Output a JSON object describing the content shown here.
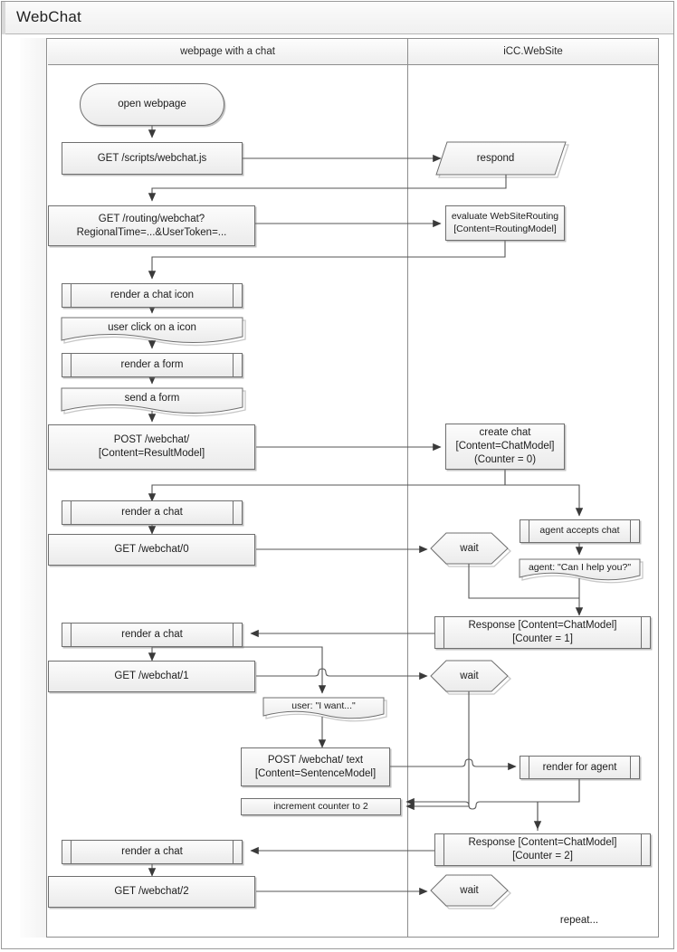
{
  "window": {
    "title": "WebChat"
  },
  "lanes": [
    {
      "id": "client",
      "label": "webpage with a chat"
    },
    {
      "id": "server",
      "label": "iCC.WebSite"
    }
  ],
  "nodes": {
    "open_webpage": {
      "label": "open webpage",
      "shape": "terminator",
      "lane": "client"
    },
    "get_webchat_js": {
      "label": "GET /scripts/webchat.js",
      "shape": "process",
      "lane": "client"
    },
    "respond": {
      "label": "respond",
      "shape": "parallelogram",
      "lane": "server"
    },
    "get_routing": {
      "label": "GET /routing/webchat?\nRegionalTime=...&UserToken=...",
      "shape": "process",
      "lane": "client"
    },
    "evaluate_routing": {
      "label": "evaluate WebSiteRouting\n[Content=RoutingModel]",
      "shape": "process",
      "lane": "server"
    },
    "render_chat_icon": {
      "label": "render a chat icon",
      "shape": "predefined-process",
      "lane": "client"
    },
    "user_click_icon": {
      "label": "user click on a icon",
      "shape": "document",
      "lane": "client"
    },
    "render_form": {
      "label": "render a form",
      "shape": "predefined-process",
      "lane": "client"
    },
    "send_form": {
      "label": "send a form",
      "shape": "document",
      "lane": "client"
    },
    "post_webchat": {
      "label": "POST /webchat/\n[Content=ResultModel]",
      "shape": "process",
      "lane": "client"
    },
    "create_chat": {
      "label": "create chat\n[Content=ChatModel]\n(Counter = 0)",
      "shape": "process",
      "lane": "server"
    },
    "render_chat_1": {
      "label": "render a chat",
      "shape": "predefined-process",
      "lane": "client"
    },
    "get_webchat_0": {
      "label": "GET /webchat/0",
      "shape": "process",
      "lane": "client"
    },
    "wait_1": {
      "label": "wait",
      "shape": "hexagon",
      "lane": "server"
    },
    "agent_accepts": {
      "label": "agent accepts chat",
      "shape": "predefined-process",
      "lane": "server"
    },
    "agent_question": {
      "label": "agent: \"Can I help you?\"",
      "shape": "document",
      "lane": "server"
    },
    "response_1": {
      "label": "Response [Content=ChatModel]\n[Counter = 1]",
      "shape": "predefined-process",
      "lane": "server"
    },
    "render_chat_2": {
      "label": "render a chat",
      "shape": "predefined-process",
      "lane": "client"
    },
    "get_webchat_1": {
      "label": "GET /webchat/1",
      "shape": "process",
      "lane": "client"
    },
    "wait_2": {
      "label": "wait",
      "shape": "hexagon",
      "lane": "server"
    },
    "user_sentence": {
      "label": "user: \"I want...\"",
      "shape": "document",
      "lane": "client"
    },
    "post_webchat_text": {
      "label": "POST /webchat/ text\n[Content=SentenceModel]",
      "shape": "process",
      "lane": "client"
    },
    "render_for_agent": {
      "label": "render for agent",
      "shape": "predefined-process",
      "lane": "server"
    },
    "increment_counter": {
      "label": "increment counter to 2",
      "shape": "process",
      "lane": "client"
    },
    "response_2": {
      "label": "Response [Content=ChatModel]\n[Counter = 2]",
      "shape": "predefined-process",
      "lane": "server"
    },
    "render_chat_3": {
      "label": "render a chat",
      "shape": "predefined-process",
      "lane": "client"
    },
    "get_webchat_2": {
      "label": "GET /webchat/2",
      "shape": "process",
      "lane": "client"
    },
    "wait_3": {
      "label": "wait",
      "shape": "hexagon",
      "lane": "server"
    },
    "repeat": {
      "label": "repeat...",
      "shape": "text",
      "lane": "server"
    }
  },
  "colors": {
    "shape_stroke": "#6f6f6f",
    "connector": "#555555",
    "frame": "#8d8d8d",
    "fill_top": "#fcfcfc",
    "fill_bottom": "#ebebeb"
  }
}
